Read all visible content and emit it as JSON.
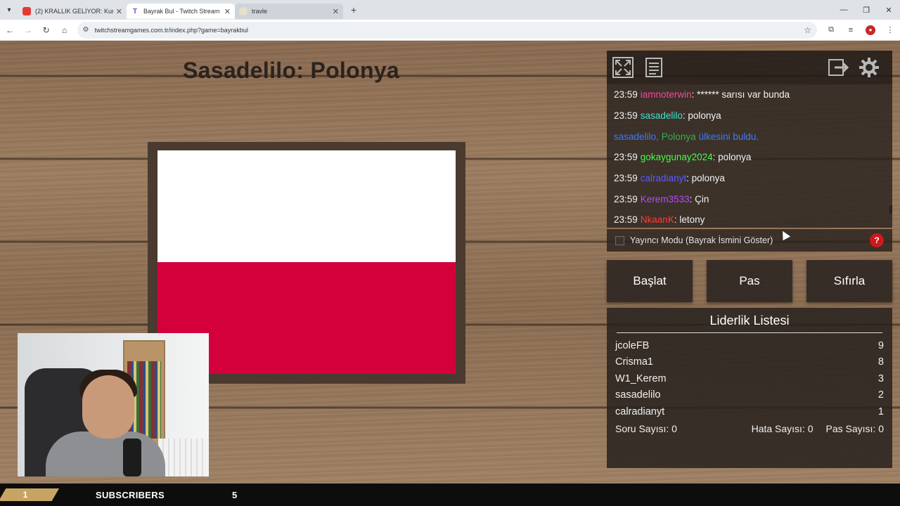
{
  "browser": {
    "tabs": [
      {
        "title": "(2) KRALLIK GELİYOR: Kurtuluş",
        "favicon_color": "#e53935",
        "active": false
      },
      {
        "title": "Bayrak Bul - Twitch Stream Gam",
        "favicon_color": "#ffffff",
        "active": true
      },
      {
        "title": "travle",
        "favicon_color": "#d4d8dc",
        "active": false
      }
    ],
    "url": "twitchstreamgames.com.tr/index.php?game=bayrakbul"
  },
  "game": {
    "title": "Sasadelilo: Polonya",
    "flag_colors": {
      "top": "#ffffff",
      "bottom": "#d4003c"
    }
  },
  "chat": {
    "lines": [
      {
        "time": "23:59",
        "user": "iamnoterwin",
        "color": "#ff3fa4",
        "msg": ": ****** sarısı var bunda"
      },
      {
        "time": "23:59",
        "user": "sasadelilo",
        "color": "#3fe0c8",
        "msg": ": polonya"
      },
      {
        "time": "",
        "user": "sasadelilo,",
        "color": "#3a7bff",
        "msg": "",
        "system": {
          "country": "Polonya",
          "country_color": "#2fb34a",
          "text": "ülkesini buldu.",
          "text_color": "#3a7bff"
        }
      },
      {
        "time": "23:59",
        "user": "gokaygunay2024",
        "color": "#4cff4c",
        "msg": ": polonya"
      },
      {
        "time": "23:59",
        "user": "calradianyt",
        "color": "#5a5aff",
        "msg": ": polonya"
      },
      {
        "time": "23:59",
        "user": "Kerem3533",
        "color": "#b24bff",
        "msg": ": Çin"
      },
      {
        "time": "23:59",
        "user": "NkaanK",
        "color": "#ff3b3b",
        "msg": ": letony"
      }
    ]
  },
  "streamer_mode_label": "Yayıncı Modu (Bayrak İsmini Göster)",
  "help_label": "?",
  "buttons": {
    "start": "Başlat",
    "pass": "Pas",
    "reset": "Sıfırla"
  },
  "leaderboard": {
    "title": "Liderlik Listesi",
    "rows": [
      {
        "name": "jcoleFB",
        "score": "9"
      },
      {
        "name": "Crisma1",
        "score": "8"
      },
      {
        "name": "W1_Kerem",
        "score": "3"
      },
      {
        "name": "sasadelilo",
        "score": "2"
      },
      {
        "name": "calradianyt",
        "score": "1"
      }
    ],
    "stats": {
      "questions": "Soru Sayısı: 0",
      "errors": "Hata Sayısı: 0",
      "passes": "Pas Sayısı: 0"
    }
  },
  "ticker": {
    "badge": "1",
    "label": "SUBSCRIBERS",
    "count": "5"
  },
  "icons": [
    "fullscreen-icon",
    "document-icon",
    "exit-icon",
    "settings-gear-icon"
  ]
}
